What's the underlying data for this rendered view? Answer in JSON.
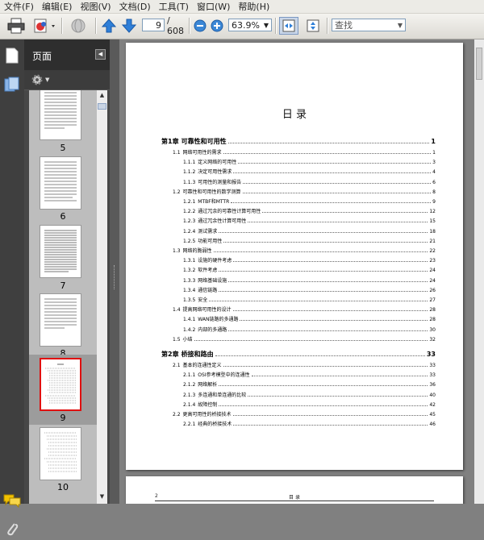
{
  "menu": [
    "文件(F)",
    "编辑(E)",
    "视图(V)",
    "文档(D)",
    "工具(T)",
    "窗口(W)",
    "帮助(H)"
  ],
  "toolbar": {
    "page_current": "9",
    "page_total": "/ 608",
    "zoom": "63.9%",
    "find_placeholder": "查找"
  },
  "nav_panel": {
    "title": "页面"
  },
  "thumbnails": [
    {
      "label": "5"
    },
    {
      "label": "6"
    },
    {
      "label": "7"
    },
    {
      "label": "8"
    },
    {
      "label": "9"
    },
    {
      "label": "10"
    }
  ],
  "doc": {
    "heading": "日  录",
    "toc": [
      {
        "level": 0,
        "num": "第1章",
        "title": "可靠性和可用性",
        "page": "1"
      },
      {
        "level": 1,
        "num": "1.1",
        "title": "网络可用性的需求",
        "page": "1"
      },
      {
        "level": 2,
        "num": "1.1.1",
        "title": "定义网络的可用性",
        "page": "3"
      },
      {
        "level": 2,
        "num": "1.1.2",
        "title": "决定可用性需求",
        "page": "4"
      },
      {
        "level": 2,
        "num": "1.1.3",
        "title": "可用性的测量和报告",
        "page": "6"
      },
      {
        "level": 1,
        "num": "1.2",
        "title": "可靠性和可用性的数学测算",
        "page": "8"
      },
      {
        "level": 2,
        "num": "1.2.1",
        "title": "MTBF和MTTR",
        "page": "9"
      },
      {
        "level": 2,
        "num": "1.2.2",
        "title": "通过冗余的可靠性计算可用性",
        "page": "12"
      },
      {
        "level": 2,
        "num": "1.2.3",
        "title": "通过冗余性计算可用性",
        "page": "15"
      },
      {
        "level": 2,
        "num": "1.2.4",
        "title": "测试需求",
        "page": "18"
      },
      {
        "level": 2,
        "num": "1.2.5",
        "title": "功能可用性",
        "page": "21"
      },
      {
        "level": 1,
        "num": "1.3",
        "title": "网络的脆弱性",
        "page": "22"
      },
      {
        "level": 2,
        "num": "1.3.1",
        "title": "设施的硬件考虑",
        "page": "23"
      },
      {
        "level": 2,
        "num": "1.3.2",
        "title": "软件考虑",
        "page": "24"
      },
      {
        "level": 2,
        "num": "1.3.3",
        "title": "网络基础设施",
        "page": "24"
      },
      {
        "level": 2,
        "num": "1.3.4",
        "title": "通信链路",
        "page": "26"
      },
      {
        "level": 2,
        "num": "1.3.5",
        "title": "安全",
        "page": "27"
      },
      {
        "level": 1,
        "num": "1.4",
        "title": "提高网络可用性的设计",
        "page": "28"
      },
      {
        "level": 2,
        "num": "1.4.1",
        "title": "WAN链路的多通路",
        "page": "28"
      },
      {
        "level": 2,
        "num": "1.4.2",
        "title": "内部的多通路",
        "page": "30"
      },
      {
        "level": 1,
        "num": "1.5",
        "title": "小结",
        "page": "32"
      },
      {
        "level": 0,
        "num": "第2章",
        "title": "桥接和路由",
        "page": "33"
      },
      {
        "level": 1,
        "num": "2.1",
        "title": "基本的连通性定义",
        "page": "33"
      },
      {
        "level": 2,
        "num": "2.1.1",
        "title": "OSI参考模型中的连通性",
        "page": "33"
      },
      {
        "level": 2,
        "num": "2.1.2",
        "title": "网络解析",
        "page": "36"
      },
      {
        "level": 2,
        "num": "2.1.3",
        "title": "多连通和单连通的比较",
        "page": "40"
      },
      {
        "level": 2,
        "num": "2.1.4",
        "title": "故障控制",
        "page": "42"
      },
      {
        "level": 1,
        "num": "2.2",
        "title": "更高可用性的桥接技术",
        "page": "45"
      },
      {
        "level": 2,
        "num": "2.2.1",
        "title": "经典的桥接技术",
        "page": "46"
      }
    ],
    "next_page_header_left": "2",
    "next_page_header_center": "目  录"
  }
}
